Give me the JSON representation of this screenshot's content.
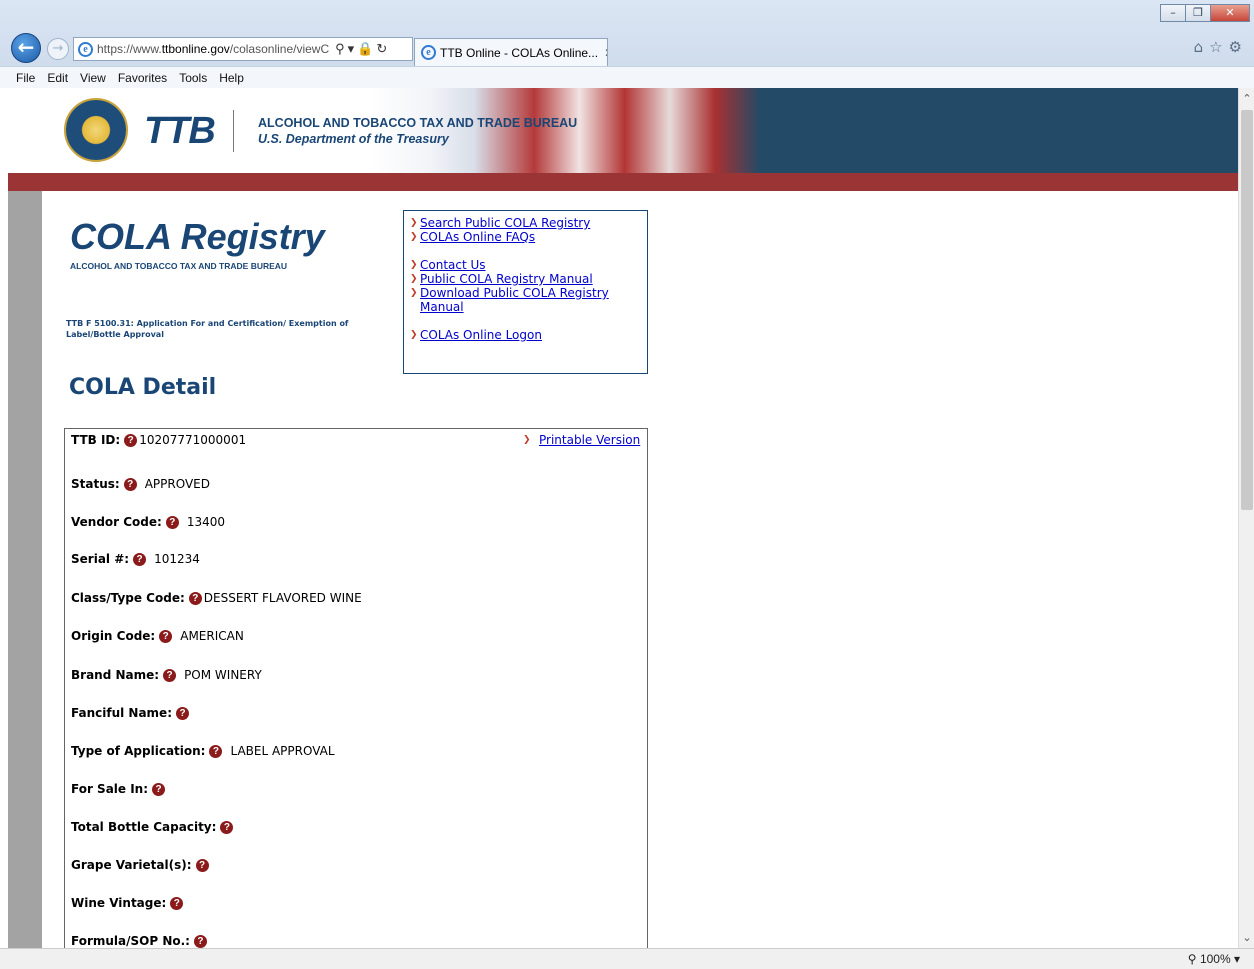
{
  "browser": {
    "url_prefix": "https://www.",
    "url_domain": "ttbonline.gov",
    "url_rest": "/colasonline/viewC",
    "tab_title": "TTB Online - COLAs Online...",
    "menu": [
      "File",
      "Edit",
      "View",
      "Favorites",
      "Tools",
      "Help"
    ],
    "zoom": "100%"
  },
  "banner": {
    "logo": "TTB",
    "bureau": "ALCOHOL AND TOBACCO TAX AND TRADE BUREAU",
    "treasury": "U.S. Department of the Treasury"
  },
  "header": {
    "logo": "COLA Registry",
    "logo_sub": "ALCOHOL AND TOBACCO TAX AND TRADE BUREAU",
    "form_title": "TTB F 5100.31: Application For and Certification/ Exemption of Label/Bottle Approval"
  },
  "links": {
    "search": "Search Public COLA Registry",
    "faqs": "COLAs Online FAQs",
    "contact": "Contact Us",
    "manual": "Public COLA Registry Manual",
    "download": "Download Public COLA Registry Manual",
    "logon": "COLAs Online Logon"
  },
  "detail": {
    "heading": "COLA Detail",
    "printable": "Printable Version",
    "fields": [
      {
        "label": "TTB ID:",
        "value": "10207771000001"
      },
      {
        "label": "Status:",
        "value": "APPROVED"
      },
      {
        "label": "Vendor Code:",
        "value": "13400"
      },
      {
        "label": "Serial #:",
        "value": "101234"
      },
      {
        "label": "Class/Type Code:",
        "value": "DESSERT FLAVORED WINE"
      },
      {
        "label": "Origin Code:",
        "value": "AMERICAN"
      },
      {
        "label": "Brand Name:",
        "value": "POM WINERY"
      },
      {
        "label": "Fanciful Name:",
        "value": ""
      },
      {
        "label": "Type of Application:",
        "value": "LABEL APPROVAL"
      },
      {
        "label": "For Sale In:",
        "value": ""
      },
      {
        "label": "Total Bottle Capacity:",
        "value": ""
      },
      {
        "label": "Grape Varietal(s):",
        "value": ""
      },
      {
        "label": "Wine Vintage:",
        "value": ""
      },
      {
        "label": "Formula/SOP No.:",
        "value": ""
      }
    ]
  }
}
